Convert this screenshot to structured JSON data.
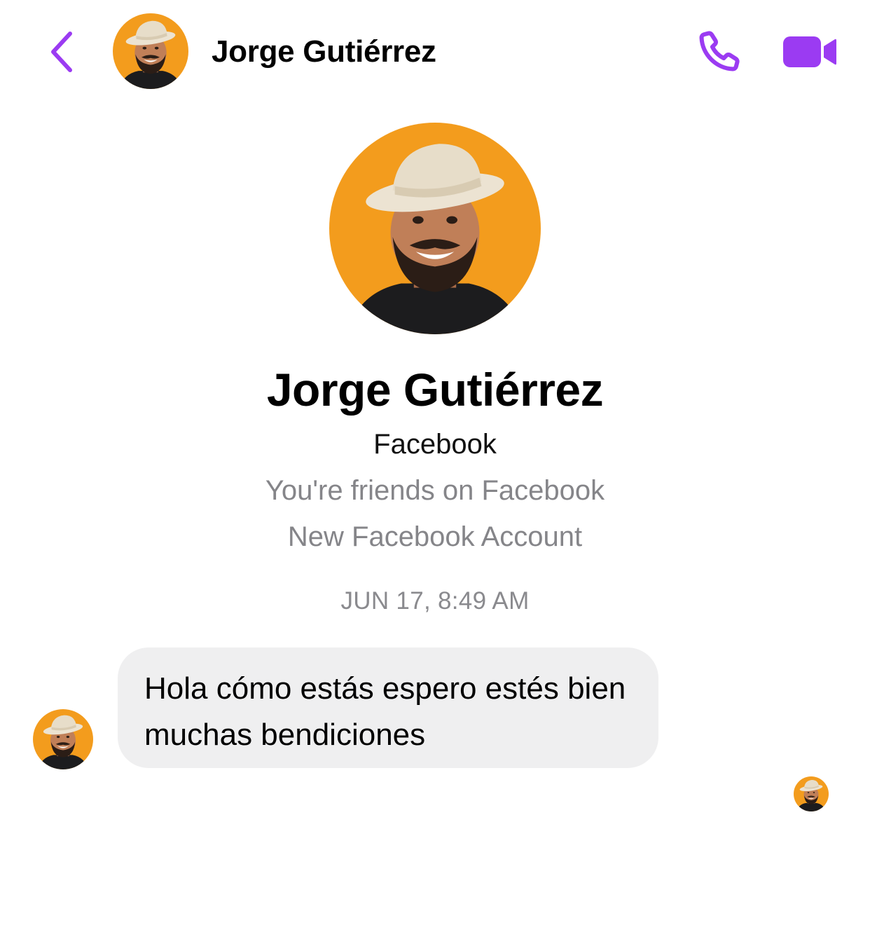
{
  "header": {
    "contact_name": "Jorge Gutiérrez",
    "back_icon": "chevron-left-icon",
    "call_icon": "phone-icon",
    "video_icon": "video-camera-icon"
  },
  "profile": {
    "name": "Jorge Gutiérrez",
    "platform": "Facebook",
    "friend_status": "You're friends on Facebook",
    "account_note": "New Facebook Account"
  },
  "conversation": {
    "timestamp": "JUN 17, 8:49 AM",
    "messages": [
      {
        "sender": "Jorge Gutiérrez",
        "text": "Hola cómo estás espero estés bien muchas bendiciones"
      }
    ]
  },
  "colors": {
    "accent": "#9b3bf2",
    "avatar_background": "#f39c1d",
    "bubble_background": "#efeff0",
    "secondary_text": "#858589"
  }
}
